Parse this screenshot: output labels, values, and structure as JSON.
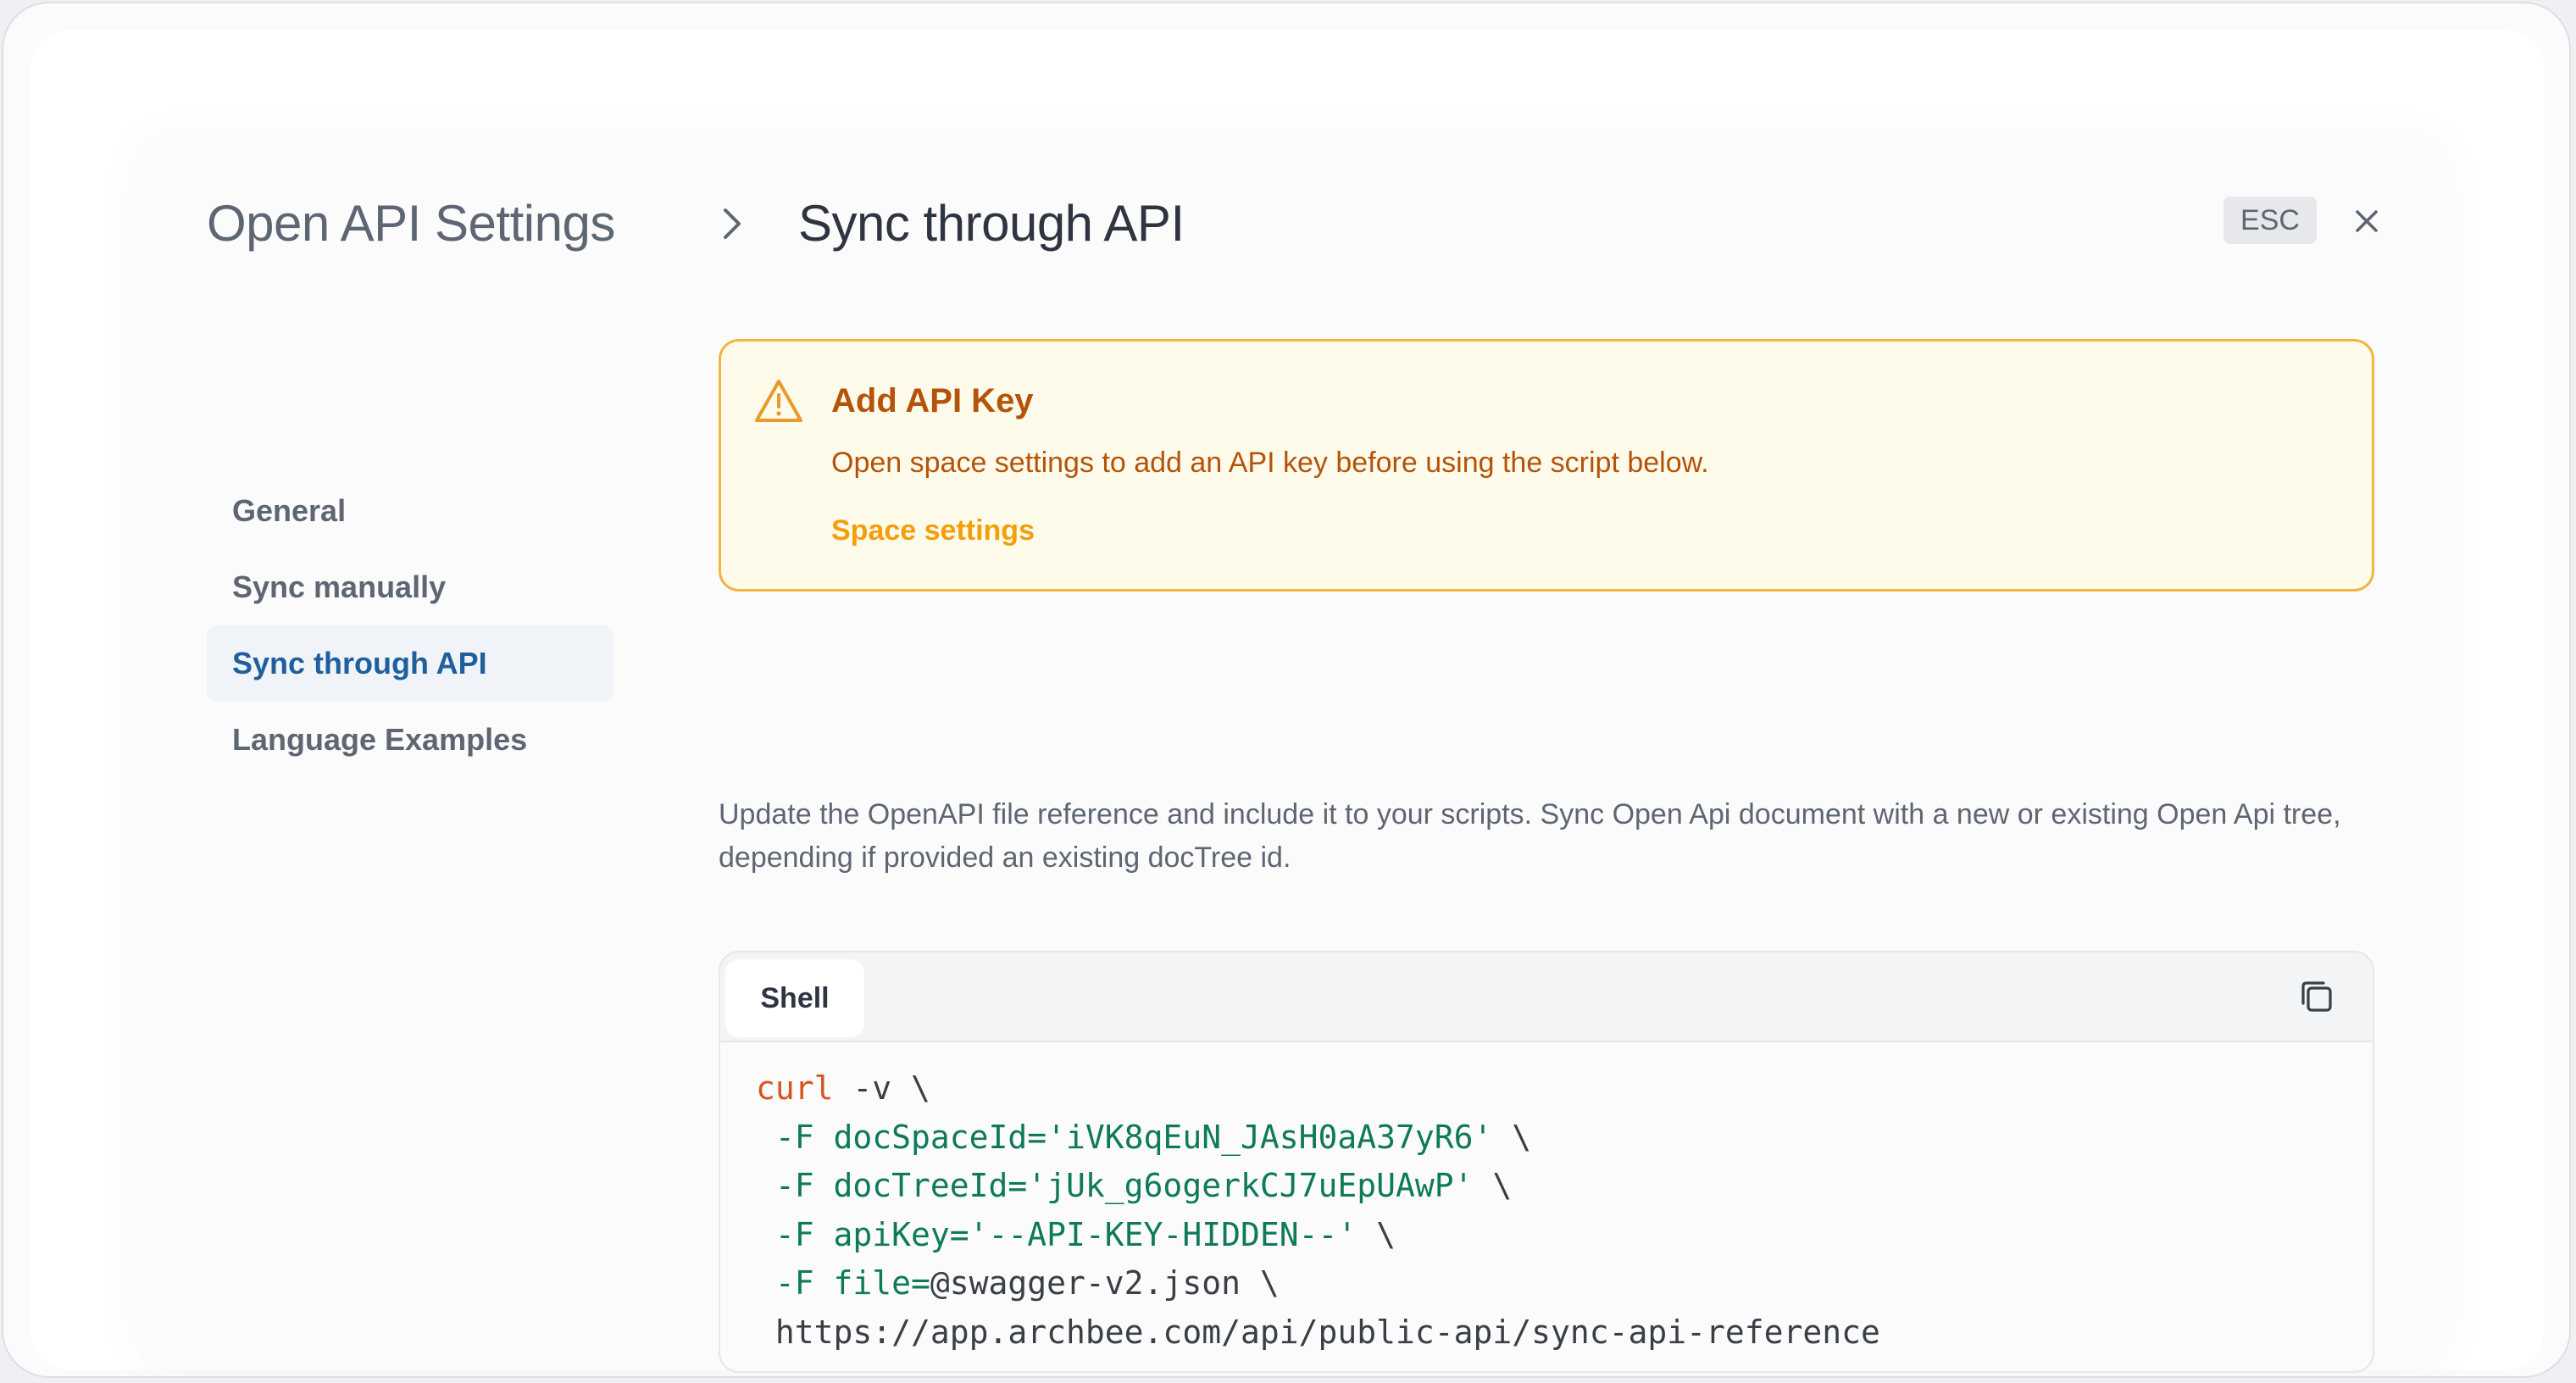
{
  "header": {
    "breadcrumb_parent": "Open API Settings",
    "breadcrumb_current": "Sync through API",
    "esc_label": "ESC"
  },
  "sidebar": {
    "items": [
      {
        "label": "General",
        "active": false
      },
      {
        "label": "Sync manually",
        "active": false
      },
      {
        "label": "Sync through API",
        "active": true
      },
      {
        "label": "Language Examples",
        "active": false
      }
    ]
  },
  "alert": {
    "title": "Add API Key",
    "description": "Open space settings to add an API key before using the script below.",
    "link_label": "Space settings"
  },
  "description": "Update the OpenAPI file reference and include it to your scripts. Sync Open Api document with a new or existing Open Api tree, depending if provided an existing docTree id.",
  "code": {
    "tab_label": "Shell",
    "lines": [
      {
        "cmd": "curl",
        "rest": " -v \\"
      },
      {
        "code": " -F docSpaceId='iVK8qEuN_JAsH0aA37yR6'",
        "tail": " \\"
      },
      {
        "code": " -F docTreeId='jUk_g6ogerkCJ7uEpUAwP'",
        "tail": " \\"
      },
      {
        "code": " -F apiKey='--API-KEY-HIDDEN--'",
        "tail": " \\"
      },
      {
        "code": " -F file=",
        "plain": "@swagger-v2.json \\"
      },
      {
        "plain": " https://app.archbee.com/api/public-api/sync-api-reference"
      }
    ]
  },
  "colors": {
    "accent_blue": "#1f5f9e",
    "warning_border": "#f2b53f",
    "warning_text": "#b45309",
    "warning_link": "#f59e0b",
    "code_command": "#d9531e",
    "code_flag": "#0f7a5a"
  },
  "icons": {
    "breadcrumb_separator": "chevron-right-icon",
    "close": "close-icon",
    "alert": "warning-triangle-icon",
    "copy": "copy-icon"
  }
}
